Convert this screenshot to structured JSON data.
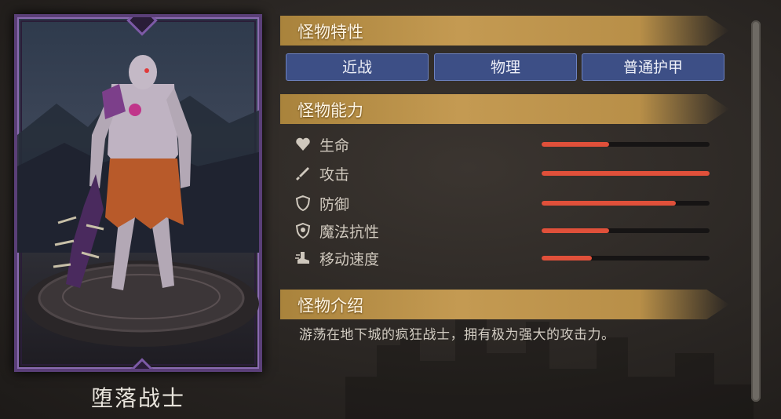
{
  "monster": {
    "name": "堕落战士"
  },
  "traits": {
    "header": "怪物特性",
    "tags": [
      "近战",
      "物理",
      "普通护甲"
    ]
  },
  "abilities": {
    "header": "怪物能力",
    "stats": [
      {
        "label": "生命",
        "icon": "heart-icon",
        "level": 0.4
      },
      {
        "label": "攻击",
        "icon": "sword-icon",
        "level": 1.0
      },
      {
        "label": "防御",
        "icon": "shield-icon",
        "level": 0.8
      },
      {
        "label": "魔法抗性",
        "icon": "magic-shield-icon",
        "level": 0.4
      },
      {
        "label": "移动速度",
        "icon": "boot-icon",
        "level": 0.3
      }
    ]
  },
  "intro": {
    "header": "怪物介绍",
    "text": "游荡在地下城的疯狂战士，拥有极为强大的攻击力。"
  },
  "colors": {
    "header_gold": "#c49a52",
    "tag_blue": "#3d4f86",
    "bar_red": "#e0503a",
    "frame_purple": "#5a3f78"
  }
}
